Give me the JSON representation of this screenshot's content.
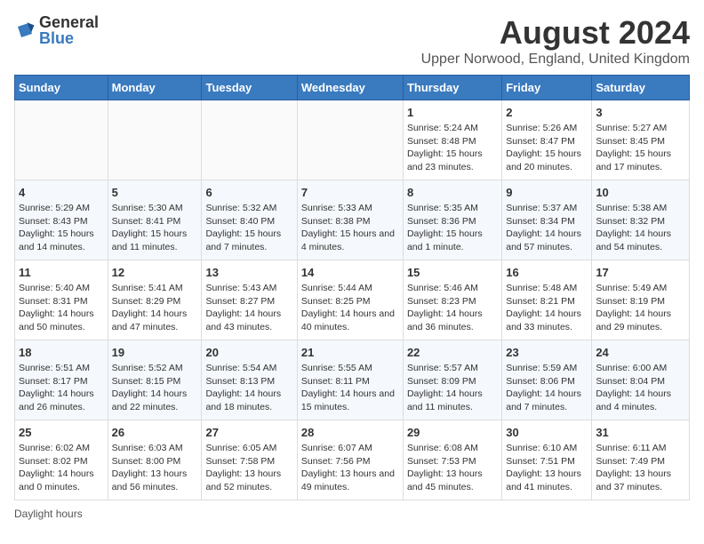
{
  "logo": {
    "text1": "General",
    "text2": "Blue"
  },
  "header": {
    "month_year": "August 2024",
    "location": "Upper Norwood, England, United Kingdom"
  },
  "weekdays": [
    "Sunday",
    "Monday",
    "Tuesday",
    "Wednesday",
    "Thursday",
    "Friday",
    "Saturday"
  ],
  "weeks": [
    [
      {
        "day": "",
        "info": ""
      },
      {
        "day": "",
        "info": ""
      },
      {
        "day": "",
        "info": ""
      },
      {
        "day": "",
        "info": ""
      },
      {
        "day": "1",
        "info": "Sunrise: 5:24 AM\nSunset: 8:48 PM\nDaylight: 15 hours and 23 minutes."
      },
      {
        "day": "2",
        "info": "Sunrise: 5:26 AM\nSunset: 8:47 PM\nDaylight: 15 hours and 20 minutes."
      },
      {
        "day": "3",
        "info": "Sunrise: 5:27 AM\nSunset: 8:45 PM\nDaylight: 15 hours and 17 minutes."
      }
    ],
    [
      {
        "day": "4",
        "info": "Sunrise: 5:29 AM\nSunset: 8:43 PM\nDaylight: 15 hours and 14 minutes."
      },
      {
        "day": "5",
        "info": "Sunrise: 5:30 AM\nSunset: 8:41 PM\nDaylight: 15 hours and 11 minutes."
      },
      {
        "day": "6",
        "info": "Sunrise: 5:32 AM\nSunset: 8:40 PM\nDaylight: 15 hours and 7 minutes."
      },
      {
        "day": "7",
        "info": "Sunrise: 5:33 AM\nSunset: 8:38 PM\nDaylight: 15 hours and 4 minutes."
      },
      {
        "day": "8",
        "info": "Sunrise: 5:35 AM\nSunset: 8:36 PM\nDaylight: 15 hours and 1 minute."
      },
      {
        "day": "9",
        "info": "Sunrise: 5:37 AM\nSunset: 8:34 PM\nDaylight: 14 hours and 57 minutes."
      },
      {
        "day": "10",
        "info": "Sunrise: 5:38 AM\nSunset: 8:32 PM\nDaylight: 14 hours and 54 minutes."
      }
    ],
    [
      {
        "day": "11",
        "info": "Sunrise: 5:40 AM\nSunset: 8:31 PM\nDaylight: 14 hours and 50 minutes."
      },
      {
        "day": "12",
        "info": "Sunrise: 5:41 AM\nSunset: 8:29 PM\nDaylight: 14 hours and 47 minutes."
      },
      {
        "day": "13",
        "info": "Sunrise: 5:43 AM\nSunset: 8:27 PM\nDaylight: 14 hours and 43 minutes."
      },
      {
        "day": "14",
        "info": "Sunrise: 5:44 AM\nSunset: 8:25 PM\nDaylight: 14 hours and 40 minutes."
      },
      {
        "day": "15",
        "info": "Sunrise: 5:46 AM\nSunset: 8:23 PM\nDaylight: 14 hours and 36 minutes."
      },
      {
        "day": "16",
        "info": "Sunrise: 5:48 AM\nSunset: 8:21 PM\nDaylight: 14 hours and 33 minutes."
      },
      {
        "day": "17",
        "info": "Sunrise: 5:49 AM\nSunset: 8:19 PM\nDaylight: 14 hours and 29 minutes."
      }
    ],
    [
      {
        "day": "18",
        "info": "Sunrise: 5:51 AM\nSunset: 8:17 PM\nDaylight: 14 hours and 26 minutes."
      },
      {
        "day": "19",
        "info": "Sunrise: 5:52 AM\nSunset: 8:15 PM\nDaylight: 14 hours and 22 minutes."
      },
      {
        "day": "20",
        "info": "Sunrise: 5:54 AM\nSunset: 8:13 PM\nDaylight: 14 hours and 18 minutes."
      },
      {
        "day": "21",
        "info": "Sunrise: 5:55 AM\nSunset: 8:11 PM\nDaylight: 14 hours and 15 minutes."
      },
      {
        "day": "22",
        "info": "Sunrise: 5:57 AM\nSunset: 8:09 PM\nDaylight: 14 hours and 11 minutes."
      },
      {
        "day": "23",
        "info": "Sunrise: 5:59 AM\nSunset: 8:06 PM\nDaylight: 14 hours and 7 minutes."
      },
      {
        "day": "24",
        "info": "Sunrise: 6:00 AM\nSunset: 8:04 PM\nDaylight: 14 hours and 4 minutes."
      }
    ],
    [
      {
        "day": "25",
        "info": "Sunrise: 6:02 AM\nSunset: 8:02 PM\nDaylight: 14 hours and 0 minutes."
      },
      {
        "day": "26",
        "info": "Sunrise: 6:03 AM\nSunset: 8:00 PM\nDaylight: 13 hours and 56 minutes."
      },
      {
        "day": "27",
        "info": "Sunrise: 6:05 AM\nSunset: 7:58 PM\nDaylight: 13 hours and 52 minutes."
      },
      {
        "day": "28",
        "info": "Sunrise: 6:07 AM\nSunset: 7:56 PM\nDaylight: 13 hours and 49 minutes."
      },
      {
        "day": "29",
        "info": "Sunrise: 6:08 AM\nSunset: 7:53 PM\nDaylight: 13 hours and 45 minutes."
      },
      {
        "day": "30",
        "info": "Sunrise: 6:10 AM\nSunset: 7:51 PM\nDaylight: 13 hours and 41 minutes."
      },
      {
        "day": "31",
        "info": "Sunrise: 6:11 AM\nSunset: 7:49 PM\nDaylight: 13 hours and 37 minutes."
      }
    ]
  ],
  "footer": {
    "note": "Daylight hours"
  }
}
